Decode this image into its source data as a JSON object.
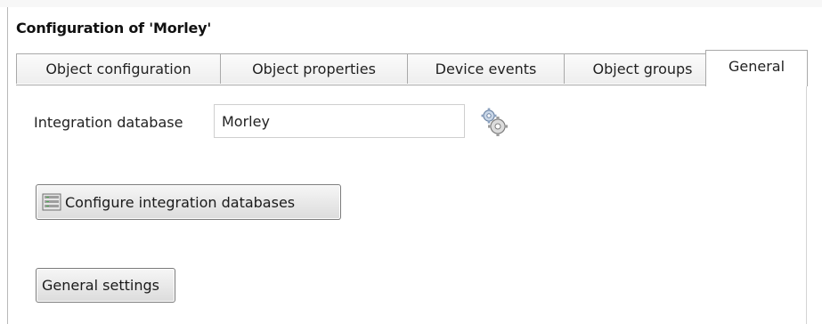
{
  "window": {
    "title": "Configuration of 'Morley'"
  },
  "tabs": [
    {
      "label": "Object configuration",
      "active": false
    },
    {
      "label": "Object properties",
      "active": false
    },
    {
      "label": "Device events",
      "active": false
    },
    {
      "label": "Object groups",
      "active": false
    },
    {
      "label": "General",
      "active": true
    }
  ],
  "general": {
    "integration_database_label": "Integration database",
    "integration_database_value": "Morley",
    "settings_icon": "gear-icon",
    "configure_button_icon": "database-icon",
    "configure_button_label": "Configure integration databases",
    "general_settings_label": "General settings"
  },
  "colors": {
    "border": "#a9a9a9",
    "button_top": "#f6f6f6",
    "button_bottom": "#dcdcdc",
    "active_tab": "#ffffff",
    "inactive_tab": "#eeeeee"
  }
}
